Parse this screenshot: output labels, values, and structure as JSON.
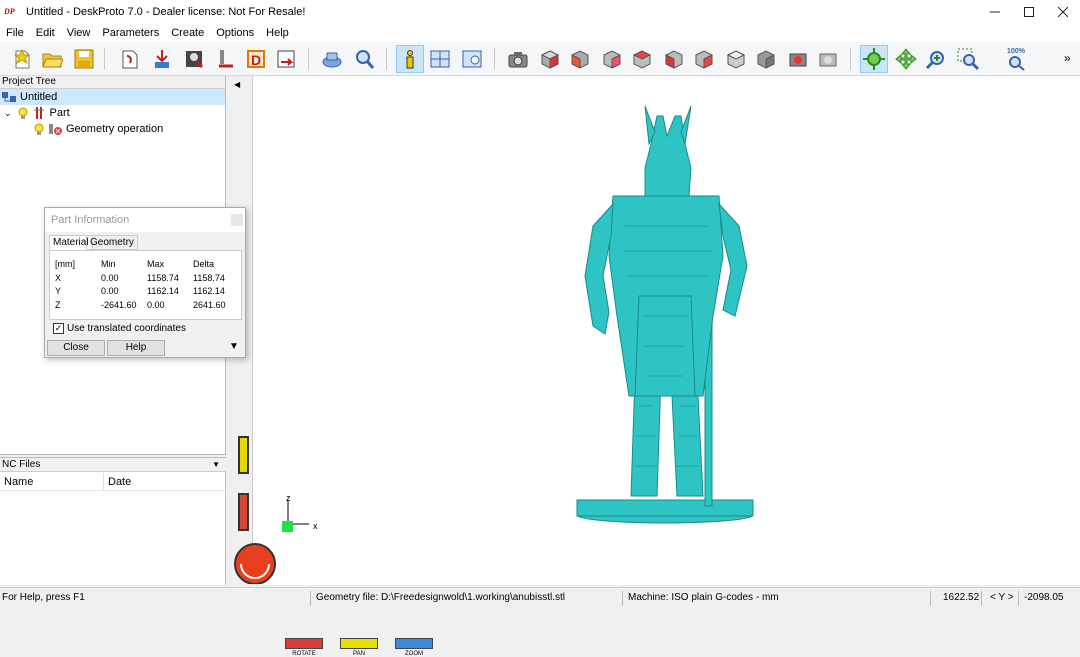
{
  "window": {
    "title": "Untitled - DeskProto 7.0 - Dealer license: Not For Resale!",
    "logo": "DP"
  },
  "menu": [
    "File",
    "Edit",
    "View",
    "Parameters",
    "Create",
    "Options",
    "Help"
  ],
  "toolbar": {
    "zoom_pct": "100%"
  },
  "project_tree": {
    "header": "Project Tree",
    "root": "Untitled",
    "part": "Part",
    "operation": "Geometry operation"
  },
  "nc_files": {
    "header": "NC Files",
    "col_name": "Name",
    "col_date": "Date"
  },
  "part_info": {
    "title": "Part Information",
    "tab_material": "Material",
    "tab_geometry": "Geometry",
    "headers": [
      "[mm]",
      "Min",
      "Max",
      "Delta"
    ],
    "rows": [
      [
        "X",
        "0.00",
        "1158.74",
        "1158.74"
      ],
      [
        "Y",
        "0.00",
        "1162.14",
        "1162.14"
      ],
      [
        "Z",
        "-2641.60",
        "0.00",
        "2641.60"
      ]
    ],
    "checkbox_label": "Use translated coordinates",
    "close_label": "Close",
    "help_label": "Help"
  },
  "viewport": {
    "axis_z": "z",
    "axis_x": "x",
    "modes": [
      "ROTATE",
      "PAN",
      "ZOOM"
    ],
    "model_color": "#2ec4c4"
  },
  "status": {
    "help": "For Help, press F1",
    "geometry_file": "Geometry file: D:\\Freedesignwold\\1.working\\anubisstl.stl",
    "machine": "Machine: ISO plain G-codes - mm",
    "coord1": "1622.52",
    "axis": "< Y >",
    "coord2": "-2098.05"
  }
}
